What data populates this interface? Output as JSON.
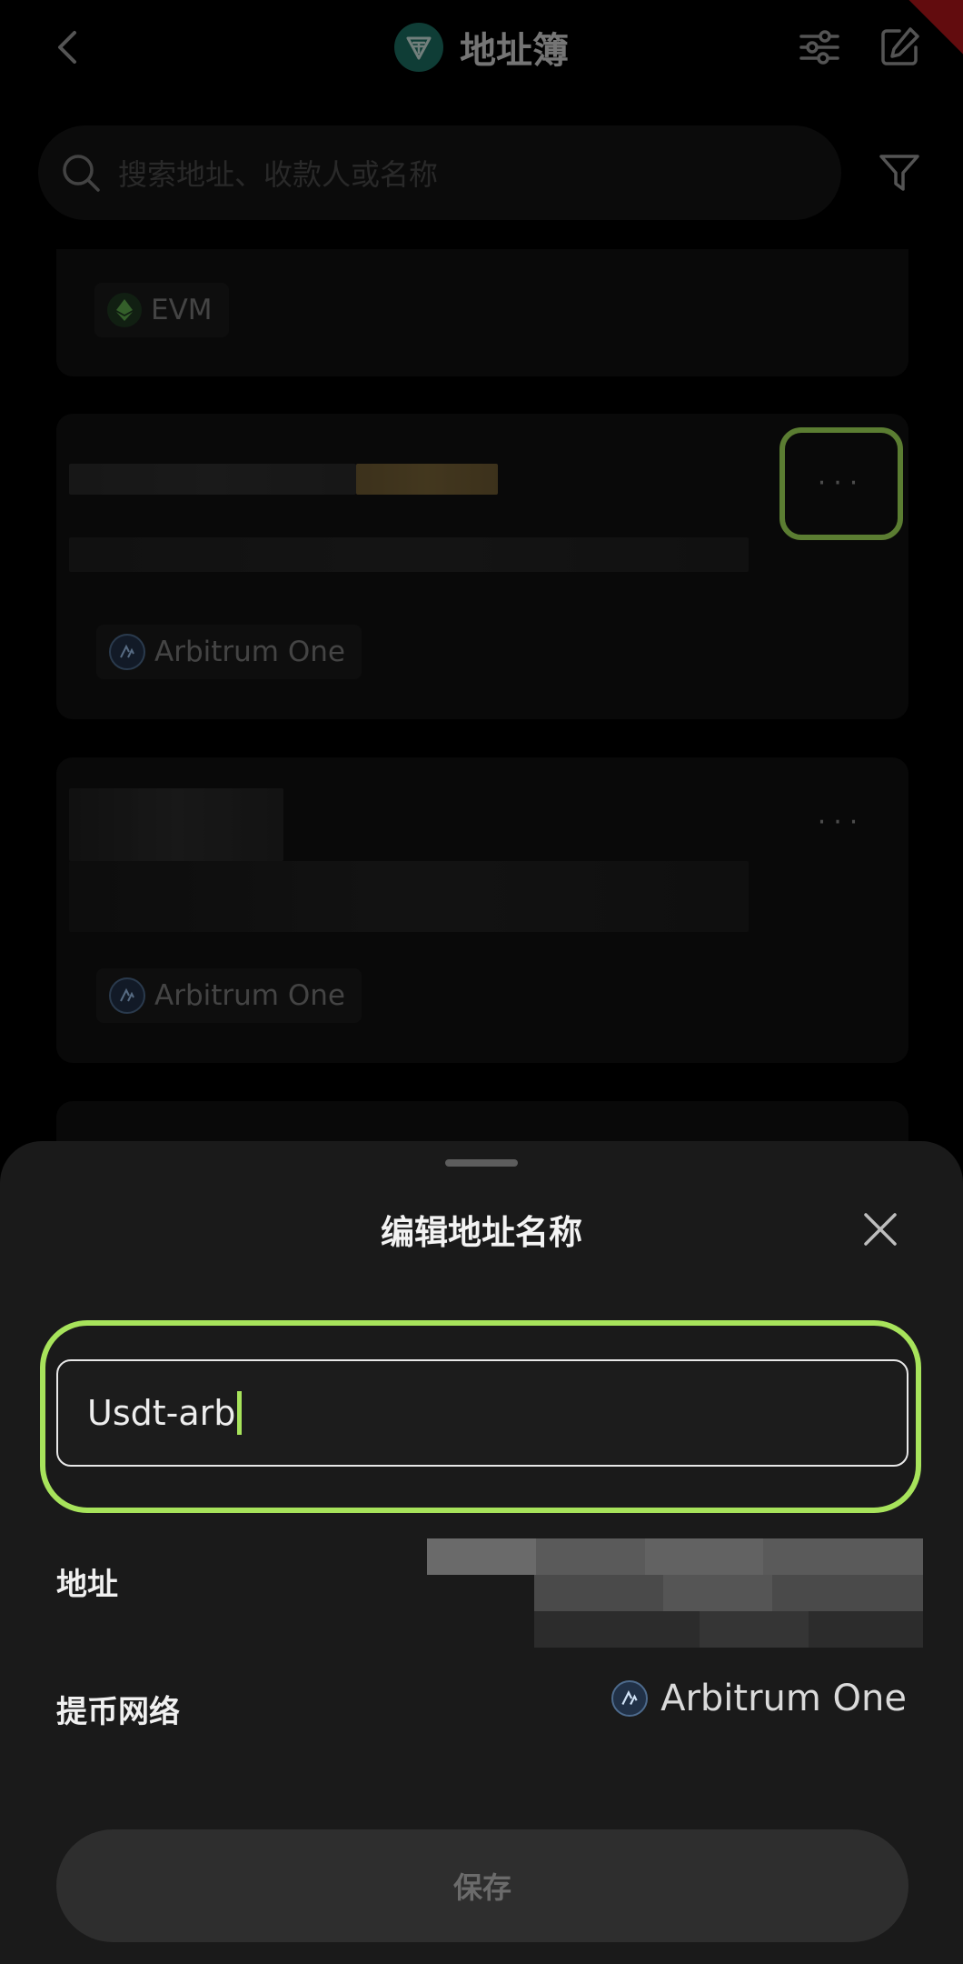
{
  "header": {
    "title": "地址簿",
    "back_icon": "chevron-left-icon",
    "tune_icon": "sliders-icon",
    "edit_icon": "edit-icon",
    "logo_icon": "tether-logo-icon"
  },
  "search": {
    "placeholder": "搜索地址、收款人或名称",
    "icon": "search-icon",
    "filter_icon": "filter-icon"
  },
  "list": {
    "items": [
      {
        "network": "EVM"
      },
      {
        "network": "Arbitrum One"
      },
      {
        "network": "Arbitrum One"
      }
    ],
    "more_label": "···"
  },
  "sheet": {
    "title": "编辑地址名称",
    "close_icon": "close-icon",
    "name_value": "Usdt-arb",
    "address_label": "地址",
    "network_label": "提币网络",
    "network_value": "Arbitrum One",
    "save_label": "保存"
  },
  "colors": {
    "highlight": "#a7e35b",
    "background": "#000000",
    "sheet": "#1a1a1a",
    "logo": "#1d6f63"
  }
}
